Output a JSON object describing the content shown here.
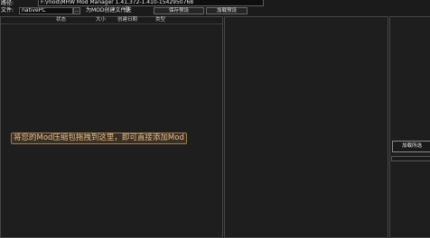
{
  "toolbar": {
    "row1_label": "路径:",
    "path_value": "F:\\mod\\MHW Mod Manager 1.41.372-1.410-1542950768",
    "file_label": "文件:",
    "file_value": "nativePC",
    "open_button": "...",
    "drag_label": "为MOD创建文件夹",
    "drag_value": "是",
    "save_button": "保存预设",
    "load_button": "加载预设"
  },
  "mod_list": {
    "columns": [
      "状态",
      "大小",
      "创建日期",
      "类型"
    ],
    "empty_hint": "将您的Mod压缩包拖拽到这里，即可直接添加Mod"
  },
  "side_panel": {
    "add_button": "加载所选"
  }
}
